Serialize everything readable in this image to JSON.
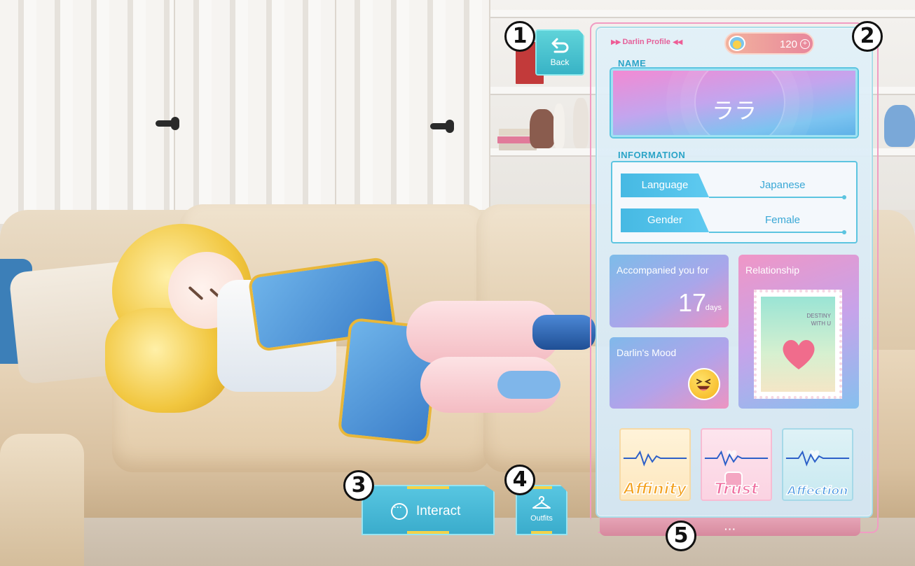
{
  "back_button": {
    "label": "Back",
    "icon": "return-arrow-icon"
  },
  "panel": {
    "title": "Darlin Profile",
    "title_arrows_left": "▶▶",
    "title_arrows_right": "◀◀",
    "currency": {
      "value": "120",
      "plus": "+",
      "icon": "coin-icon"
    },
    "name_section": {
      "label": "NAME",
      "value": "ララ"
    },
    "information_section": {
      "label": "INFORMATION",
      "rows": [
        {
          "key": "Language",
          "value": "Japanese"
        },
        {
          "key": "Gender",
          "value": "Female"
        }
      ]
    },
    "accompanied": {
      "label": "Accompanied you for",
      "days": "17",
      "unit": "days"
    },
    "mood": {
      "label": "Darlin's Mood",
      "icon": "laughing-face-icon"
    },
    "relationship": {
      "label": "Relationship",
      "stamp_text_line1": "DESTINY",
      "stamp_text_line2": "WITH U"
    },
    "stats": [
      {
        "label": "Affinity",
        "color": "#f3a11e"
      },
      {
        "label": "Trust",
        "color": "#ef6fa0"
      },
      {
        "label": "Affection",
        "color": "#3b8ee0"
      }
    ],
    "footer": "···"
  },
  "bottom_buttons": {
    "interact": {
      "label": "Interact",
      "icon": "chat-bubble-icon"
    },
    "outfits": {
      "label": "Outfits",
      "icon": "hanger-icon"
    }
  },
  "callouts": [
    "1",
    "2",
    "3",
    "4",
    "5"
  ]
}
